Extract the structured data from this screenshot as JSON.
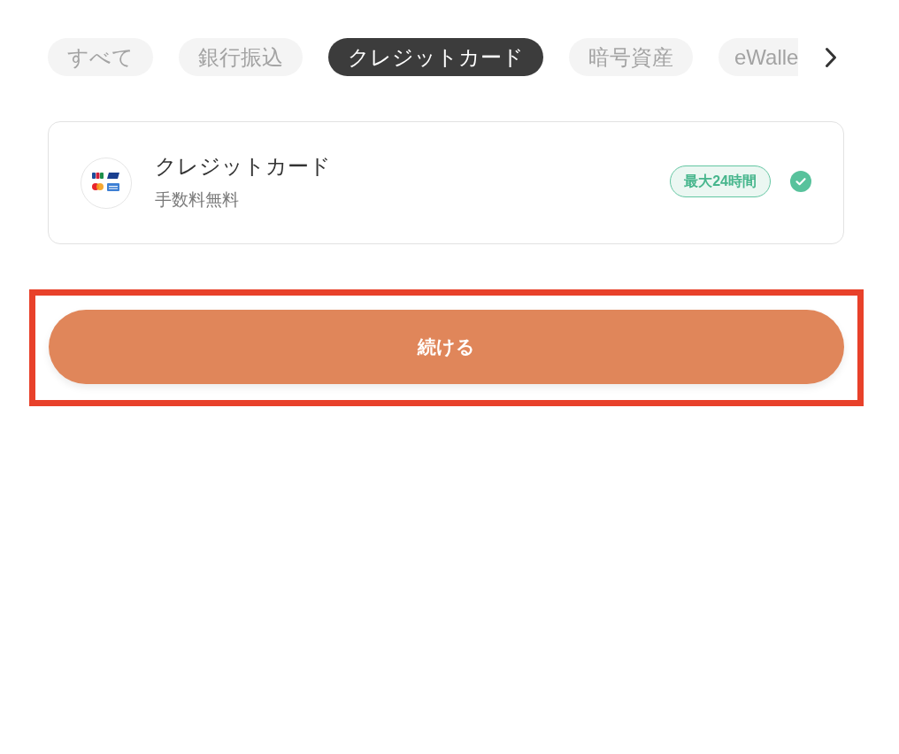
{
  "tabs": [
    {
      "label": "すべて",
      "selected": false
    },
    {
      "label": "銀行振込",
      "selected": false
    },
    {
      "label": "クレジットカード",
      "selected": true
    },
    {
      "label": "暗号資産",
      "selected": false
    },
    {
      "label": "eWalle",
      "selected": false
    }
  ],
  "methods": [
    {
      "title": "クレジットカード",
      "subtitle": "手数料無料",
      "badge": "最大24時間",
      "selected": true
    }
  ],
  "continue_button": {
    "label": "続ける",
    "highlighted": true
  }
}
